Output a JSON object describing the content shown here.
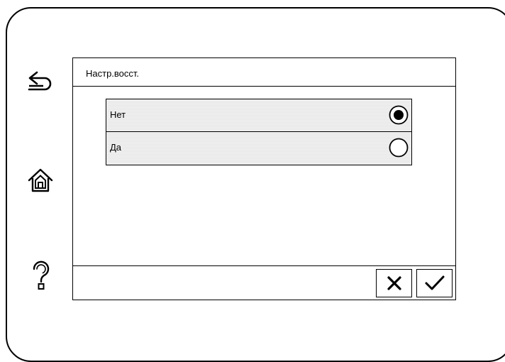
{
  "screen": {
    "title": "Настр.восст.",
    "options": [
      {
        "label": "Нет",
        "selected": true
      },
      {
        "label": "Да",
        "selected": false
      }
    ]
  },
  "side_icons": {
    "back": "back-arrow-icon",
    "home": "home-icon",
    "help": "help-icon"
  },
  "buttons": {
    "cancel": "close-icon",
    "ok": "checkmark-icon"
  }
}
